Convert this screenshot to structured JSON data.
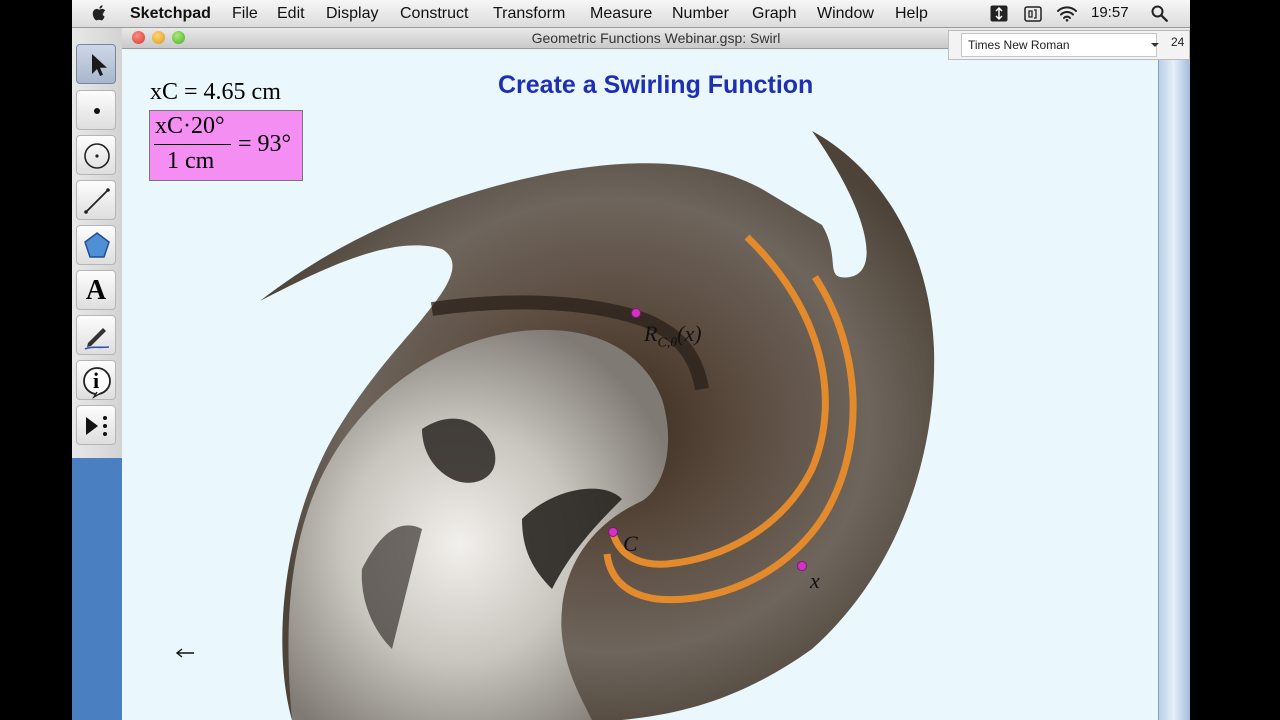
{
  "menubar": {
    "app_name": "Sketchpad",
    "items": [
      "File",
      "Edit",
      "Display",
      "Construct",
      "Transform",
      "Measure",
      "Number",
      "Graph",
      "Window",
      "Help"
    ],
    "clock": "19:57"
  },
  "toolbar": {
    "tools": [
      "arrow-select-tool",
      "point-tool",
      "compass-tool",
      "straightedge-tool",
      "polygon-tool",
      "text-tool",
      "marker-tool",
      "information-tool",
      "custom-tool"
    ],
    "text_tool_glyph": "A",
    "info_tool_glyph": "i"
  },
  "window": {
    "title": "Geometric Functions Webinar.gsp: Swirl"
  },
  "fontbar": {
    "font": "Times New Roman",
    "size": "24"
  },
  "canvas": {
    "title": "Create a Swirling Function",
    "measurement": "xC = 4.65 cm",
    "calculation": {
      "numerator": "xC·20°",
      "denominator": "1 cm",
      "result": "= 93°"
    },
    "points": {
      "rotated_label": "R_{C,θ}(x)",
      "center_label": "C",
      "x_label": "x"
    }
  },
  "colors": {
    "title_blue": "#1f2fb5",
    "calc_bg": "#f48ef2",
    "point_magenta": "#d630c8",
    "canvas_bg": "#eaf7fc",
    "swirl_stripe": "#e38a2c"
  }
}
